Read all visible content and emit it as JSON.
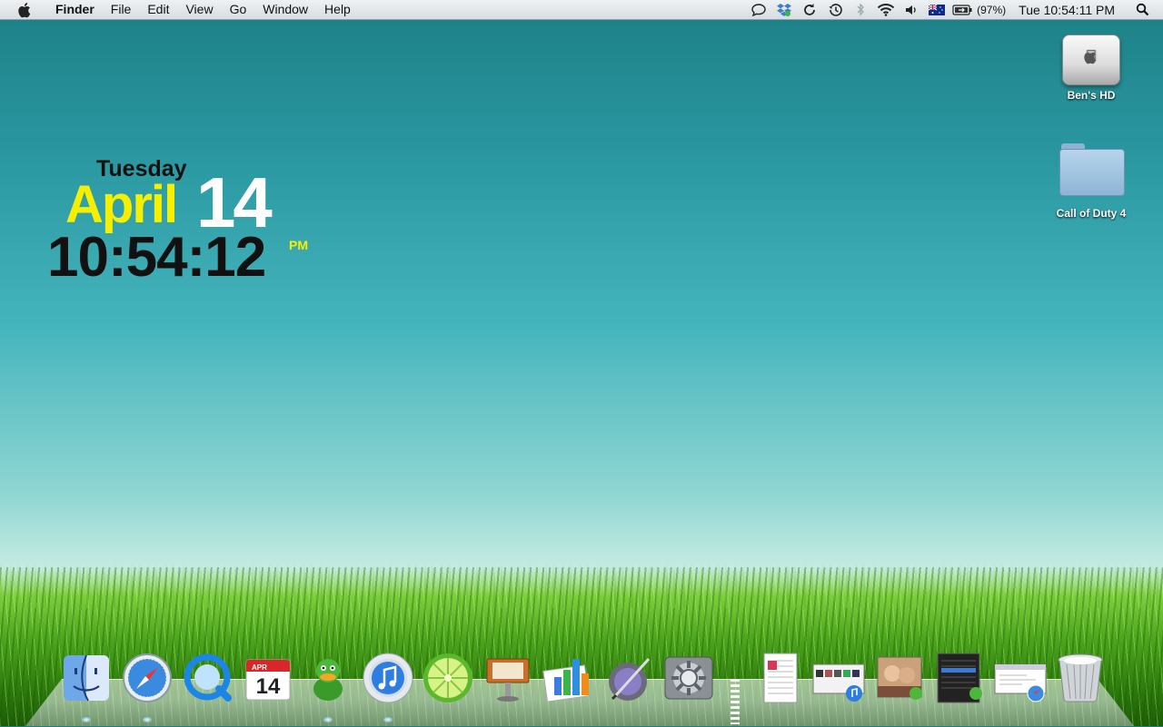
{
  "menubar": {
    "apple_icon": "apple-icon",
    "menus": [
      "Finder",
      "File",
      "Edit",
      "View",
      "Go",
      "Window",
      "Help"
    ],
    "status_icons": [
      "chat-bubble-icon",
      "dropbox-icon",
      "sync-icon",
      "time-machine-icon",
      "bluetooth-icon",
      "wifi-icon",
      "volume-icon",
      "australia-flag-icon",
      "battery-icon"
    ],
    "battery_text": "(97%)",
    "clock": "Tue 10:54:11 PM",
    "spotlight_icon": "spotlight-icon"
  },
  "widget": {
    "day": "Tuesday",
    "month": "April",
    "date": "14",
    "time": "10:54:12",
    "ampm": "PM"
  },
  "desktop_icons": [
    {
      "label": "Ben's HD",
      "icon": "hard-drive-icon"
    },
    {
      "label": "Call of Duty 4",
      "icon": "folder-icon"
    }
  ],
  "calendar_icon": {
    "month": "APR",
    "day": "14"
  },
  "dock": [
    {
      "icon": "finder-icon"
    },
    {
      "icon": "safari-icon"
    },
    {
      "icon": "quicktime-icon"
    },
    {
      "icon": "ical-icon"
    },
    {
      "icon": "adium-icon"
    },
    {
      "icon": "itunes-icon"
    },
    {
      "icon": "limewire-icon"
    },
    {
      "icon": "keynote-icon"
    },
    {
      "icon": "numbers-icon"
    },
    {
      "icon": "script-editor-icon"
    },
    {
      "icon": "system-preferences-icon"
    },
    {
      "icon": "document-stack-icon"
    },
    {
      "icon": "itunes-window-icon"
    },
    {
      "icon": "photo-window-icon"
    },
    {
      "icon": "adium-window-icon"
    },
    {
      "icon": "safari-window-icon"
    },
    {
      "icon": "trash-icon"
    }
  ],
  "colors": {
    "menubar_bg": "#dde3e6",
    "widget_yellow": "#f6f000",
    "sky_top": "#1d7f86",
    "grass": "#4da61b"
  }
}
